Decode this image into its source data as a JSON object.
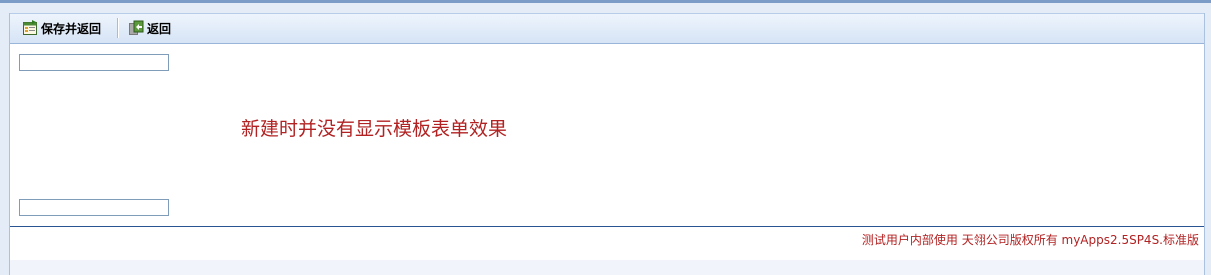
{
  "toolbar": {
    "save_return_label": "保存并返回",
    "save_return_icon": "save-return-icon",
    "back_label": "返回",
    "back_icon": "back-icon"
  },
  "form": {
    "field1_value": "",
    "field2_value": ""
  },
  "message": "新建时并没有显示模板表单效果",
  "footer": {
    "copyright": "测试用户内部使用  天翎公司版权所有  myApps2.5SP4S.标准版"
  },
  "colors": {
    "message": "#b22222",
    "footer_text": "#b22222",
    "toolbar_bg": "#d6e4f6",
    "footer_border": "#2b5592"
  }
}
